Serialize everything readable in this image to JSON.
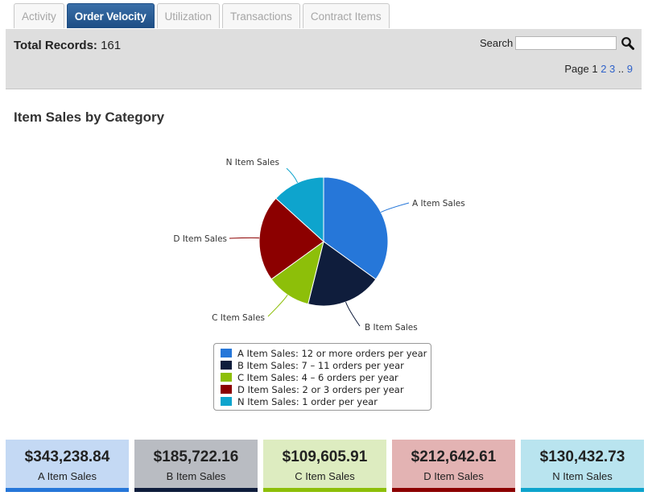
{
  "tabs": [
    {
      "label": "Activity",
      "active": false
    },
    {
      "label": "Order Velocity",
      "active": true
    },
    {
      "label": "Utilization",
      "active": false
    },
    {
      "label": "Transactions",
      "active": false
    },
    {
      "label": "Contract Items",
      "active": false
    }
  ],
  "header": {
    "total_label": "Total Records:",
    "total_value": "161",
    "search_label": "Search",
    "search_value": "",
    "pager": {
      "prefix": "Page",
      "current": "1",
      "links": [
        "2",
        "3"
      ],
      "ellipsis": "..",
      "last": "9"
    }
  },
  "chart_title": "Item Sales by Category",
  "chart_data": {
    "type": "pie",
    "title": "Item Sales by Category",
    "slices": [
      {
        "label": "A Item Sales",
        "value": 343238.84,
        "color": "#2677d9",
        "legend": "A Item Sales: 12 or more orders per year"
      },
      {
        "label": "B Item Sales",
        "value": 185722.16,
        "color": "#0f1d3c",
        "legend": "B Item Sales: 7 – 11 orders per year"
      },
      {
        "label": "C Item Sales",
        "value": 109605.91,
        "color": "#8dbf09",
        "legend": "C Item Sales: 4 – 6 orders per year"
      },
      {
        "label": "D Item Sales",
        "value": 212642.61,
        "color": "#8c0000",
        "legend": "D Item Sales: 2 or 3 orders per year"
      },
      {
        "label": "N Item Sales",
        "value": 130432.73,
        "color": "#0ea4cd",
        "legend": "N Item Sales: 1 order per year"
      }
    ]
  },
  "cards": [
    {
      "value": "$343,238.84",
      "label": "A Item Sales",
      "bg": "#c4d9f4",
      "accent": "#2677d9"
    },
    {
      "value": "$185,722.16",
      "label": "B Item Sales",
      "bg": "#b9bcc2",
      "accent": "#0f1d3c"
    },
    {
      "value": "$109,605.91",
      "label": "C Item Sales",
      "bg": "#ddecc0",
      "accent": "#8dbf09"
    },
    {
      "value": "$212,642.61",
      "label": "D Item Sales",
      "bg": "#e3b3b3",
      "accent": "#8c0000"
    },
    {
      "value": "$130,432.73",
      "label": "N Item Sales",
      "bg": "#b9e4ef",
      "accent": "#0ea4cd"
    }
  ]
}
